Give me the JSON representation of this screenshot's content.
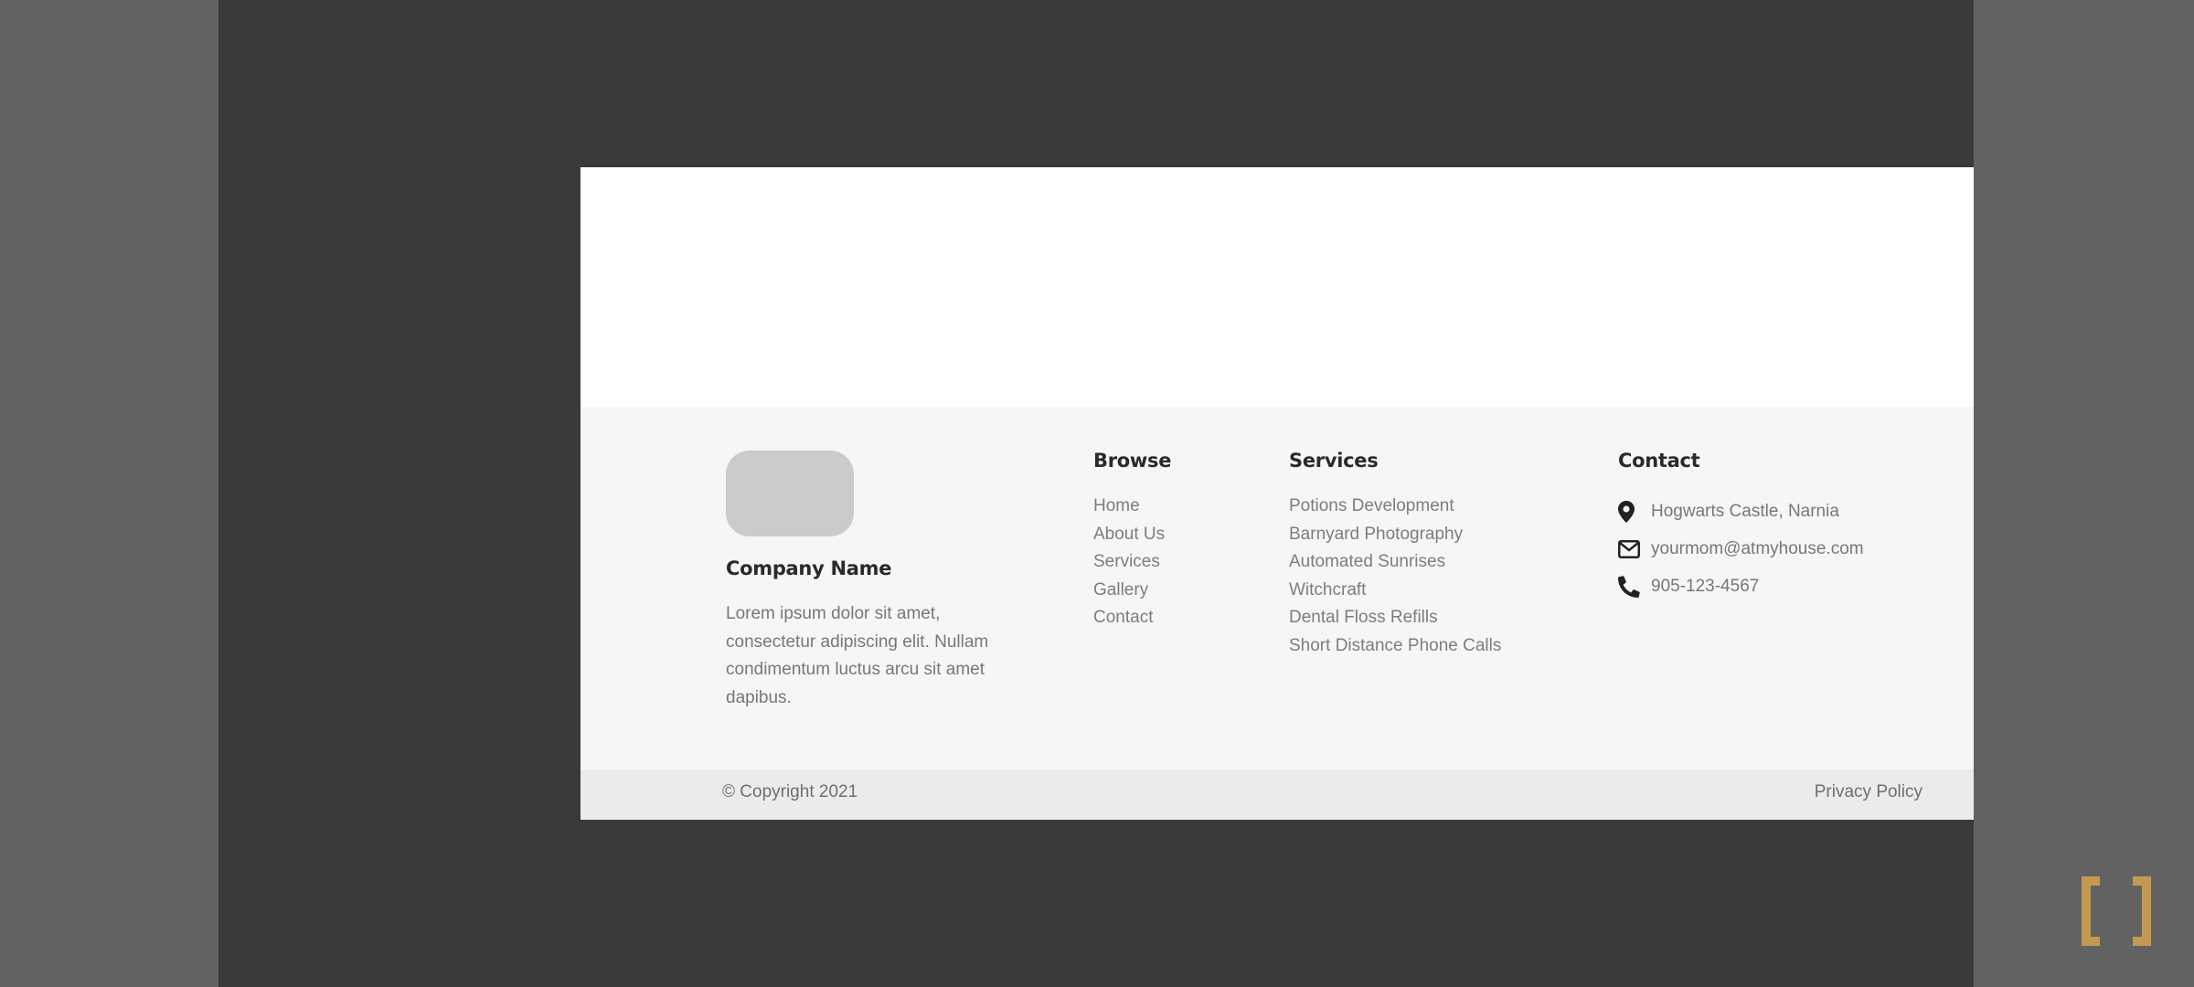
{
  "company": {
    "name": "Company Name",
    "description": "Lorem ipsum dolor sit amet, consectetur adipiscing elit. Nullam condimentum luctus arcu sit amet dapibus."
  },
  "browse": {
    "title": "Browse",
    "items": [
      {
        "label": "Home"
      },
      {
        "label": "About Us"
      },
      {
        "label": "Services"
      },
      {
        "label": "Gallery"
      },
      {
        "label": "Contact"
      }
    ]
  },
  "services": {
    "title": "Services",
    "items": [
      {
        "label": "Potions Development"
      },
      {
        "label": "Barnyard Photography"
      },
      {
        "label": "Automated Sunrises"
      },
      {
        "label": "Witchcraft"
      },
      {
        "label": "Dental Floss Refills"
      },
      {
        "label": "Short Distance Phone Calls"
      }
    ]
  },
  "contact": {
    "title": "Contact",
    "items": [
      {
        "icon": "map-pin-icon",
        "text": "Hogwarts Castle, Narnia"
      },
      {
        "icon": "envelope-icon",
        "text": "yourmom@atmyhouse.com"
      },
      {
        "icon": "phone-icon",
        "text": "905-123-4567"
      }
    ]
  },
  "bottom_bar": {
    "copyright": "© Copyright 2021",
    "privacy": "Privacy Policy"
  },
  "colors": {
    "stage_bg": "#3a3a3a",
    "footer_bg": "#f6f6f6",
    "bottom_bar_bg": "#ebebeb",
    "brand_mark": "#c49a52"
  },
  "brand_mark_icon": "bracket-logo-icon"
}
